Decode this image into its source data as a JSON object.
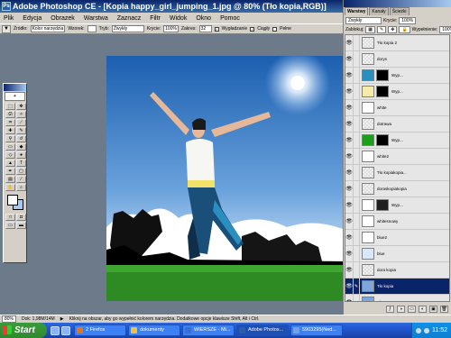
{
  "window": {
    "title": "Adobe Photoshop CE - [Kopia happy_girl_jumping_1.jpg @ 80% (Tło kopia,RGB)]",
    "app_icon": "Ps",
    "controls": [
      "_",
      "□",
      "×"
    ]
  },
  "menu": [
    "Plik",
    "Edycja",
    "Obrazek",
    "Warstwa",
    "Zaznacz",
    "Filtr",
    "Widok",
    "Okno",
    "Pomoc"
  ],
  "options": {
    "source_label": "Źródło:",
    "source_value": "Kolor narzędzia",
    "pattern_label": "Wzorek:",
    "mode_label": "Tryb:",
    "mode_value": "Zwykły",
    "opacity_label": "Krycie:",
    "opacity_value": "100%",
    "tolerance_label": "Zakres:",
    "tolerance_value": "32",
    "antialias_label": "Wygładzanie",
    "contiguous_label": "Ciągły",
    "all_layers_label": "Pełne"
  },
  "layers_panel": {
    "tabs": [
      "Warstwy",
      "Kanały",
      "Ścieżki"
    ],
    "blend_mode": "Zwykły",
    "opacity_label": "Krycie:",
    "opacity_value": "100%",
    "lock_label": "Zablokuj:",
    "fill_label": "Wypełnienie:",
    "fill_value": "100%",
    "layers": [
      {
        "name": "Tło kopia 2",
        "thumb": "#f0f0f0",
        "mask": null,
        "selected": false
      },
      {
        "name": "dorys",
        "thumb": "#f4f4f4",
        "mask": null,
        "selected": false
      },
      {
        "name": "Wyp...",
        "thumb": "#2a8fbf",
        "mask": "#000000",
        "selected": false
      },
      {
        "name": "Wyp...",
        "thumb": "#f4eba8",
        "mask": "#000000",
        "selected": false
      },
      {
        "name": "white",
        "thumb": "#ffffff",
        "mask": null,
        "selected": false
      },
      {
        "name": "dotrawa",
        "thumb": "#f0f0f0",
        "mask": null,
        "selected": false
      },
      {
        "name": "Wyp...",
        "thumb": "#1aa01a",
        "mask": "#000000",
        "selected": false
      },
      {
        "name": "white2",
        "thumb": "#ffffff",
        "mask": null,
        "selected": false
      },
      {
        "name": "Tło kopiakopia...",
        "thumb": "#f0f0f0",
        "mask": null,
        "selected": false
      },
      {
        "name": "doraskopiakopia",
        "thumb": "#f0f0f0",
        "mask": null,
        "selected": false
      },
      {
        "name": "Wyp...",
        "thumb": "#ffffff",
        "mask": "#202020",
        "selected": false
      },
      {
        "name": "whitesnowy",
        "thumb": "#ffffff",
        "mask": null,
        "selected": false
      },
      {
        "name": "blue2",
        "thumb": "#ffffff",
        "mask": null,
        "selected": false
      },
      {
        "name": "blue",
        "thumb": "#d8e8f8",
        "mask": null,
        "selected": false
      },
      {
        "name": "dora kopia",
        "thumb": "#f0f0f0",
        "mask": null,
        "selected": false
      },
      {
        "name": "Tło kopia",
        "thumb": "#7fa6d8",
        "mask": null,
        "selected": true
      },
      {
        "name": "Tło",
        "thumb": "#7fa6d8",
        "mask": null,
        "selected": false
      }
    ]
  },
  "status": {
    "zoom": "80%",
    "doc": "Dok: 1,98M/14M",
    "hint": "Kliknij na obszar, aby go wypełnić kolorem narzędzia. Dodatkowe opcje klawisze Shift, Alt i Ctrl."
  },
  "taskbar": {
    "start": "Start",
    "tasks": [
      {
        "label": "2 Firefox",
        "color": "#e8731c",
        "active": false
      },
      {
        "label": "dokumenty",
        "color": "#f0c040",
        "active": false
      },
      {
        "label": "WIERSZE - Mi...",
        "color": "#3a6ed0",
        "active": false
      },
      {
        "label": "Adobe Photos...",
        "color": "#2a5fa8",
        "active": true
      },
      {
        "label": "5903295(Ned...",
        "color": "#7aa0d8",
        "active": false
      }
    ],
    "clock": "11:52"
  },
  "colors": {
    "sky_top": "#1c5fb0",
    "sky_bottom": "#cfe3f7",
    "grass": "#2e8a22",
    "jeans": "#2a8fbf",
    "selection": "#0a246a"
  }
}
